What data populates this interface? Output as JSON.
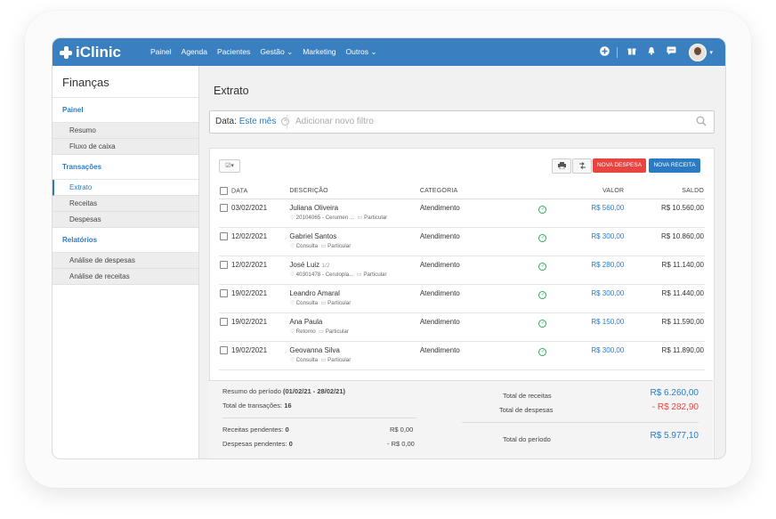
{
  "nav": {
    "brand": "iClinic",
    "menu": [
      "Painel",
      "Agenda",
      "Pacientes",
      "Gestão ⌄",
      "Marketing",
      "Outros ⌄"
    ],
    "accent": "#3a7fbf"
  },
  "sidebar": {
    "title": "Finanças",
    "section_painel": "Painel",
    "resumo": "Resumo",
    "fluxo": "Fluxo de caixa",
    "section_transacoes": "Transações",
    "extrato": "Extrato",
    "receitas": "Receitas",
    "despesas": "Despesas",
    "section_relatorios": "Relatórios",
    "analise_despesas": "Análise de despesas",
    "analise_receitas": "Análise de receitas"
  },
  "main": {
    "title": "Extrato",
    "filter_label": "Data:",
    "filter_value": "Este mês",
    "filter_placeholder": "Adicionar novo filtro"
  },
  "toolbar": {
    "new_expense": "NOVA DESPESA",
    "new_income": "NOVA RECEITA"
  },
  "table": {
    "headers": {
      "date": "DATA",
      "desc": "DESCRIÇÃO",
      "cat": "CATEGORIA",
      "valor": "VALOR",
      "saldo": "SALDO"
    },
    "rows": [
      {
        "date": "03/02/2021",
        "name": "Juliana Oliveira",
        "extra": "",
        "proc": "20104065 - Cerumen ...",
        "plan": "Particular",
        "cat": "Atendimento",
        "valor": "R$ 560,00",
        "saldo": "R$ 10.560,00"
      },
      {
        "date": "12/02/2021",
        "name": "Gabriel Santos",
        "extra": "",
        "proc": "Consulta",
        "plan": "Particular",
        "cat": "Atendimento",
        "valor": "R$ 300,00",
        "saldo": "R$ 10.860,00"
      },
      {
        "date": "12/02/2021",
        "name": "José Luiz",
        "extra": "1/2",
        "proc": "40301478 - Ceruloplа...",
        "plan": "Particular",
        "cat": "Atendimento",
        "valor": "R$ 280,00",
        "saldo": "R$ 11.140,00"
      },
      {
        "date": "19/02/2021",
        "name": "Leandro Amaral",
        "extra": "",
        "proc": "Consulta",
        "plan": "Particular",
        "cat": "Atendimento",
        "valor": "R$ 300,00",
        "saldo": "R$ 11.440,00"
      },
      {
        "date": "19/02/2021",
        "name": "Ana Paula",
        "extra": "",
        "proc": "Retorno",
        "plan": "Particular",
        "cat": "Atendimento",
        "valor": "R$ 150,00",
        "saldo": "R$ 11.590,00"
      },
      {
        "date": "19/02/2021",
        "name": "Geovanna Silva",
        "extra": "",
        "proc": "Consulta",
        "plan": "Particular",
        "cat": "Atendimento",
        "valor": "R$ 300,00",
        "saldo": "R$ 11.890,00"
      }
    ]
  },
  "summary": {
    "period_label": "Resumo do período",
    "period_range": "(01/02/21 - 28/02/21)",
    "total_tx_label": "Total de transações:",
    "total_tx": "16",
    "pend_rec_label": "Receitas pendentes:",
    "pend_rec_count": "0",
    "pend_rec_value": "R$ 0,00",
    "pend_desp_label": "Despesas pendentes:",
    "pend_desp_count": "0",
    "pend_desp_value": "- R$ 0,00",
    "total_receitas_label": "Total de receitas",
    "total_receitas": "R$ 6.260,00",
    "total_despesas_label": "Total de despesas",
    "total_despesas": "- R$ 282,90",
    "total_periodo_label": "Total do período",
    "total_periodo": "R$ 5.977,10"
  }
}
